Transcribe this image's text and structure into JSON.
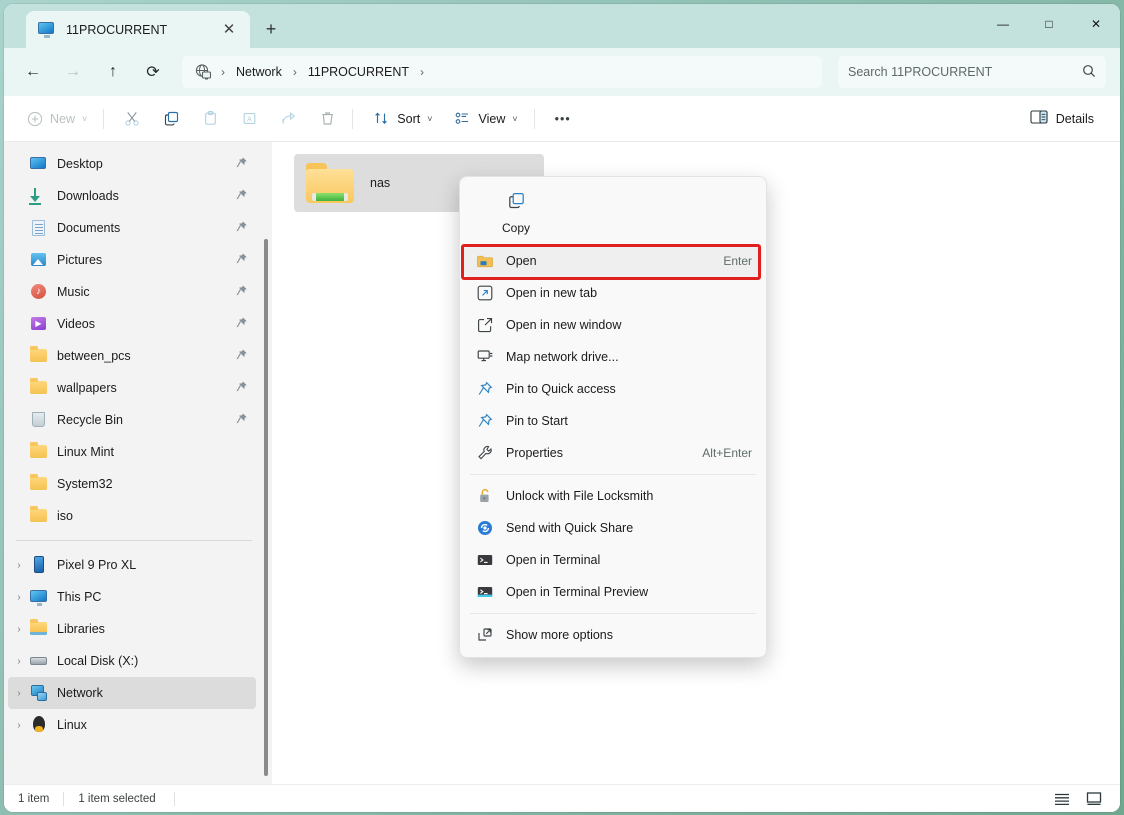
{
  "window": {
    "tab_title": "11PROCURRENT",
    "tab_icon": "monitor-icon",
    "new_tab_label": "+",
    "close_tab_label": "✕",
    "minimize_label": "—",
    "maximize_label": "□",
    "close_label": "✕"
  },
  "navbar": {
    "back_label": "←",
    "forward_label": "→",
    "up_label": "↑",
    "refresh_label": "⟳",
    "breadcrumb_icon": "network-globe-icon",
    "breadcrumbs": [
      "Network",
      "11PROCURRENT"
    ],
    "separator": "›",
    "search": {
      "placeholder": "Search 11PROCURRENT",
      "value": "",
      "icon": "search-icon"
    }
  },
  "commandbar": {
    "new_label": "New",
    "new_chevron": "˅",
    "cut_icon": "scissors-icon",
    "copy_icon": "copy-icon",
    "paste_icon": "paste-icon",
    "rename_icon": "rename-icon",
    "share_icon": "share-icon",
    "delete_icon": "trash-icon",
    "sort_label": "Sort",
    "view_label": "View",
    "overflow_label": "•••",
    "details_label": "Details"
  },
  "sidebar": {
    "quick_access": [
      {
        "label": "Desktop",
        "icon": "desktop-icon",
        "pinned": true
      },
      {
        "label": "Downloads",
        "icon": "downloads-icon",
        "pinned": true
      },
      {
        "label": "Documents",
        "icon": "documents-icon",
        "pinned": true
      },
      {
        "label": "Pictures",
        "icon": "pictures-icon",
        "pinned": true
      },
      {
        "label": "Music",
        "icon": "music-icon",
        "pinned": true
      },
      {
        "label": "Videos",
        "icon": "videos-icon",
        "pinned": true
      },
      {
        "label": "between_pcs",
        "icon": "folder-icon",
        "pinned": true
      },
      {
        "label": "wallpapers",
        "icon": "folder-icon",
        "pinned": true
      },
      {
        "label": "Recycle Bin",
        "icon": "recycle-bin-icon",
        "pinned": true
      },
      {
        "label": "Linux Mint",
        "icon": "folder-icon",
        "pinned": false
      },
      {
        "label": "System32",
        "icon": "folder-icon",
        "pinned": false
      },
      {
        "label": "iso",
        "icon": "folder-icon",
        "pinned": false
      }
    ],
    "tree": [
      {
        "label": "Pixel 9 Pro XL",
        "icon": "phone-icon",
        "chevron": "›",
        "selected": false
      },
      {
        "label": "This PC",
        "icon": "this-pc-icon",
        "chevron": "›",
        "selected": false
      },
      {
        "label": "Libraries",
        "icon": "libraries-icon",
        "chevron": "›",
        "selected": false
      },
      {
        "label": "Local Disk (X:)",
        "icon": "disk-icon",
        "chevron": "›",
        "selected": false
      },
      {
        "label": "Network",
        "icon": "network-icon",
        "chevron": "›",
        "selected": true
      },
      {
        "label": "Linux",
        "icon": "linux-icon",
        "chevron": "›",
        "selected": false
      }
    ],
    "pin_icon": "pin-icon"
  },
  "content": {
    "items": [
      {
        "name": "nas",
        "icon": "network-share-folder-icon",
        "selected": true
      }
    ]
  },
  "context_menu": {
    "command_row": [
      {
        "label": "Copy",
        "icon": "copy-icon"
      }
    ],
    "items": [
      {
        "label": "Open",
        "icon": "folder-open-icon",
        "accel": "Enter",
        "highlighted": true,
        "separator_after": false
      },
      {
        "label": "Open in new tab",
        "icon": "new-tab-icon",
        "accel": "",
        "highlighted": false,
        "separator_after": false
      },
      {
        "label": "Open in new window",
        "icon": "new-window-icon",
        "accel": "",
        "highlighted": false,
        "separator_after": false
      },
      {
        "label": "Map network drive...",
        "icon": "map-network-drive-icon",
        "accel": "",
        "highlighted": false,
        "separator_after": false
      },
      {
        "label": "Pin to Quick access",
        "icon": "pin-icon",
        "accel": "",
        "highlighted": false,
        "separator_after": false
      },
      {
        "label": "Pin to Start",
        "icon": "pin-icon",
        "accel": "",
        "highlighted": false,
        "separator_after": false
      },
      {
        "label": "Properties",
        "icon": "wrench-icon",
        "accel": "Alt+Enter",
        "highlighted": false,
        "separator_after": true
      },
      {
        "label": "Unlock with File Locksmith",
        "icon": "padlock-icon",
        "accel": "",
        "highlighted": false,
        "separator_after": false
      },
      {
        "label": "Send with Quick Share",
        "icon": "quick-share-icon",
        "accel": "",
        "highlighted": false,
        "separator_after": false
      },
      {
        "label": "Open in Terminal",
        "icon": "terminal-icon",
        "accel": "",
        "highlighted": false,
        "separator_after": false
      },
      {
        "label": "Open in Terminal Preview",
        "icon": "terminal-preview-icon",
        "accel": "",
        "highlighted": false,
        "separator_after": true
      },
      {
        "label": "Show more options",
        "icon": "show-more-icon",
        "accel": "",
        "highlighted": false,
        "separator_after": false
      }
    ],
    "highlight_color": "#e01f1f"
  },
  "statusbar": {
    "item_count": "1 item",
    "selection": "1 item selected",
    "details_view_icon": "details-view-icon",
    "large_icons_view_icon": "large-icons-view-icon"
  },
  "colors": {
    "titlebar": "#c3e2dd",
    "navbar": "#eaf6f4",
    "sidebar": "#f3f3f3",
    "accent_red": "#e01f1f",
    "selection_grey": "#dcdcdc"
  }
}
